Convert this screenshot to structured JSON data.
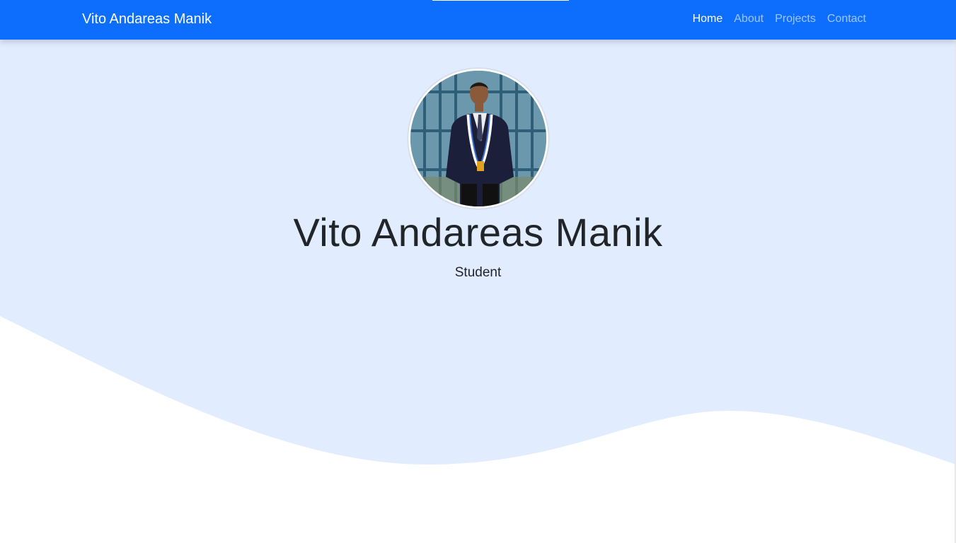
{
  "nav": {
    "brand": "Vito Andareas Manik",
    "links": [
      {
        "label": "Home",
        "active": true
      },
      {
        "label": "About",
        "active": false
      },
      {
        "label": "Projects",
        "active": false
      },
      {
        "label": "Contact",
        "active": false
      }
    ]
  },
  "hero": {
    "name": "Vito Andareas Manik",
    "role": "Student",
    "avatar_icon": "profile-photo"
  },
  "colors": {
    "navbar": "#0d6efd",
    "hero_background": "#e1ecfe",
    "wave": "#ffffff"
  }
}
